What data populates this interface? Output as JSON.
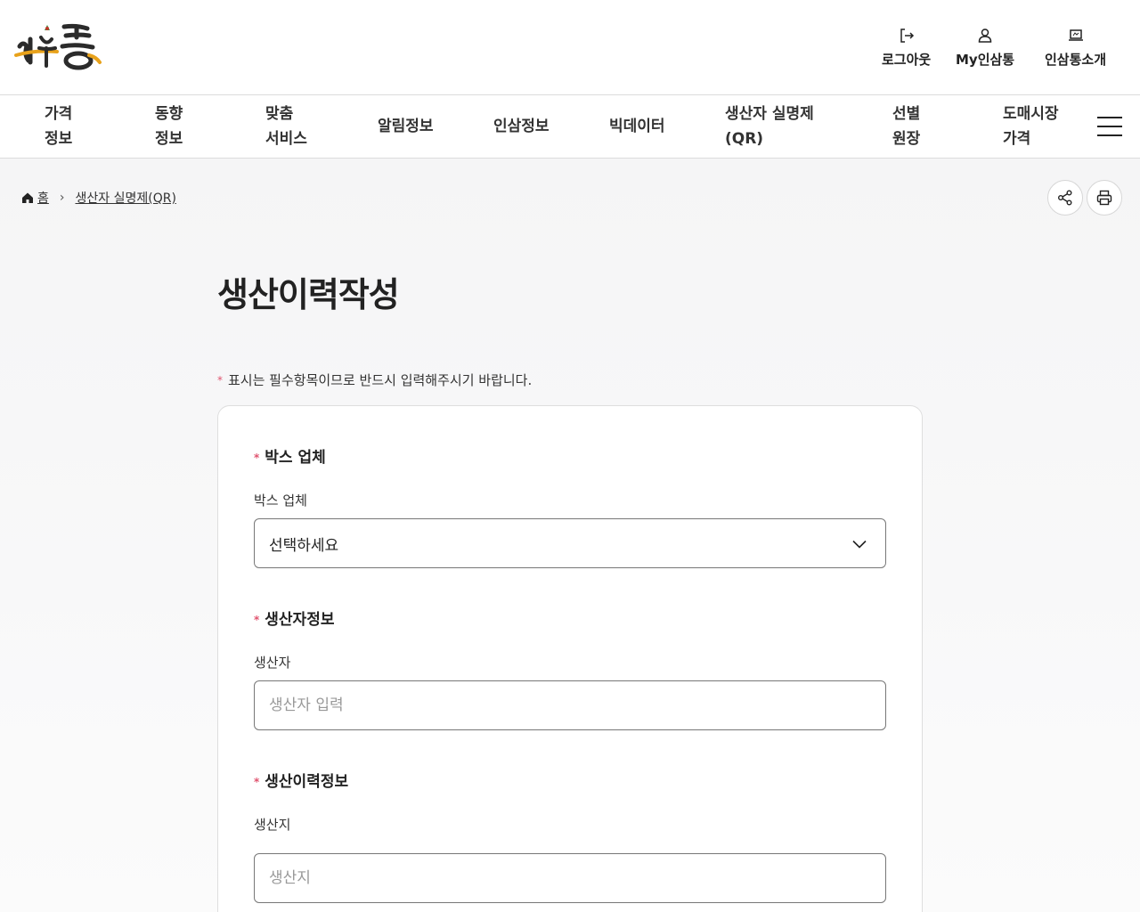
{
  "header": {
    "logo_text": "인삼통",
    "util": [
      {
        "label": "로그아웃",
        "icon": "logout-icon"
      },
      {
        "label": "My인삼통",
        "icon": "user-icon"
      },
      {
        "label": "인삼통소개",
        "icon": "laptop-icon"
      }
    ]
  },
  "gnb": {
    "items": [
      {
        "label": "가격\n정보"
      },
      {
        "label": "동향\n정보"
      },
      {
        "label": "맞춤\n서비스"
      },
      {
        "label": "알림정보"
      },
      {
        "label": "인삼정보"
      },
      {
        "label": "빅데이터"
      },
      {
        "label": "생산자 실명제\n(QR)"
      },
      {
        "label": "선별\n원장"
      },
      {
        "label": "도매시장\n가격"
      }
    ]
  },
  "breadcrumb": {
    "home": "홈",
    "current": "생산자 실명제(QR)"
  },
  "page": {
    "title": "생산이력작성",
    "notice": "표시는 필수항목이므로 반드시 입력해주시기 바랍니다.",
    "required_mark": "*"
  },
  "form": {
    "box": {
      "section": "박스 업체",
      "label": "박스 업체",
      "value": "선택하세요"
    },
    "producer": {
      "section": "생산자정보",
      "label": "생산자",
      "placeholder": "생산자 입력"
    },
    "history": {
      "section": "생산이력정보",
      "label": "생산지",
      "placeholder": "생산지"
    }
  },
  "colors": {
    "required": "#e0536f",
    "border": "#dedede"
  }
}
